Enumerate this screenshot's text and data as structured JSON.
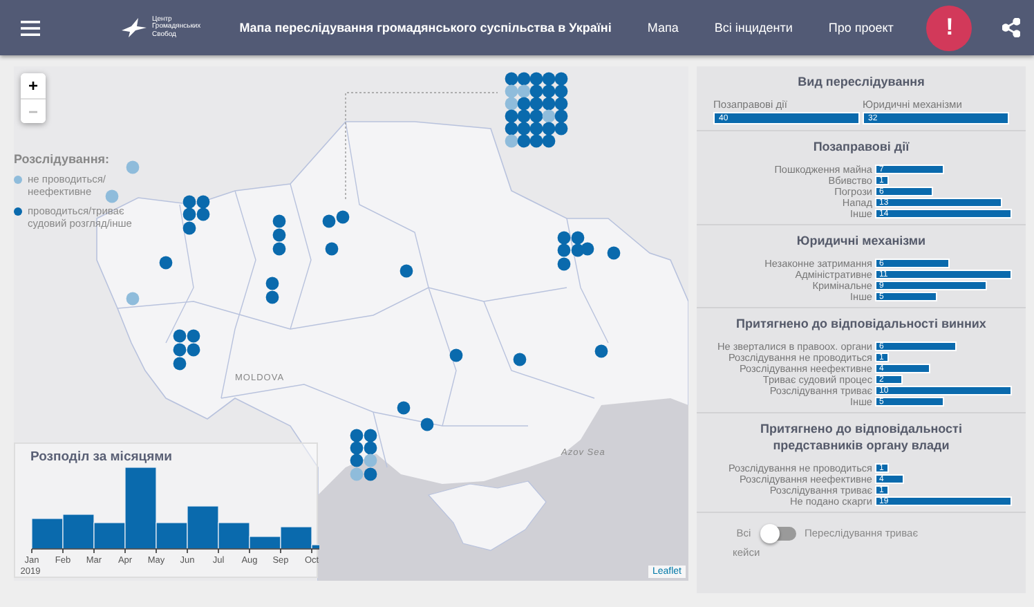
{
  "header": {
    "logo_lines": [
      "Центр",
      "Громадянських",
      "Свобод"
    ],
    "title": "Мапа переслідування громадянського суспільства в Україні",
    "nav": [
      {
        "label": "Мапа"
      },
      {
        "label": "Всі інциденти"
      },
      {
        "label": "Про проект"
      }
    ],
    "alert_button": "!"
  },
  "map": {
    "zoom_controls": [
      "+",
      "−"
    ],
    "legend": {
      "title": "Розслідування:",
      "items": [
        {
          "label": "не проводиться/ неефективне",
          "color": "#8fbcdb"
        },
        {
          "label": "проводиться/триває судовий розгляд/інше",
          "color": "#0a6aad"
        }
      ]
    },
    "labels": [
      "MOLDOVA",
      "Azov Sea"
    ],
    "attribution": "Leaflet",
    "histogram": {
      "title": "Розподіл за місяцями",
      "x_labels": [
        "Jan",
        "Feb",
        "Mar",
        "Apr",
        "May",
        "Jun",
        "Jul",
        "Aug",
        "Sep",
        "Oct"
      ],
      "year": "2019"
    }
  },
  "stats": {
    "summary": {
      "title": "Вид переслідування",
      "items": [
        {
          "label": "Позаправові дії",
          "value": "40"
        },
        {
          "label": "Юридичні механізми",
          "value": "32"
        }
      ]
    },
    "sections": [
      {
        "title": "Позаправові дії",
        "rows": [
          {
            "label": "Пошкодження майна",
            "value": "7"
          },
          {
            "label": "Вбивство",
            "value": "1"
          },
          {
            "label": "Погрози",
            "value": "6"
          },
          {
            "label": "Напад",
            "value": "13"
          },
          {
            "label": "Інше",
            "value": "14"
          }
        ]
      },
      {
        "title": "Юридичні механізми",
        "rows": [
          {
            "label": "Незаконне затримання",
            "value": "6"
          },
          {
            "label": "Адміністративне",
            "value": "11"
          },
          {
            "label": "Кримінальне",
            "value": "9"
          },
          {
            "label": "Інше",
            "value": "5"
          }
        ]
      },
      {
        "title": "Притягнено до відповідальності винних",
        "rows": [
          {
            "label": "Не зверталися в правоох. органи",
            "value": "6"
          },
          {
            "label": "Розслідування не проводиться",
            "value": "1"
          },
          {
            "label": "Розслідування неефективне",
            "value": "4"
          },
          {
            "label": "Триває судовий процес",
            "value": "2"
          },
          {
            "label": "Розслідування триває",
            "value": "10"
          },
          {
            "label": "Інше",
            "value": "5"
          }
        ]
      },
      {
        "title": "Притягнено до відповідальності представників органу влади",
        "rows": [
          {
            "label": "Розслідування не проводиться",
            "value": "1"
          },
          {
            "label": "Розслідування неефективне",
            "value": "4"
          },
          {
            "label": "Розслідування триває",
            "value": "1"
          },
          {
            "label": "Не подано скарги",
            "value": "19"
          }
        ]
      }
    ],
    "toggle": {
      "left_label": "Всі кейси",
      "right_label": "Переслідування триває",
      "on": false
    }
  }
}
